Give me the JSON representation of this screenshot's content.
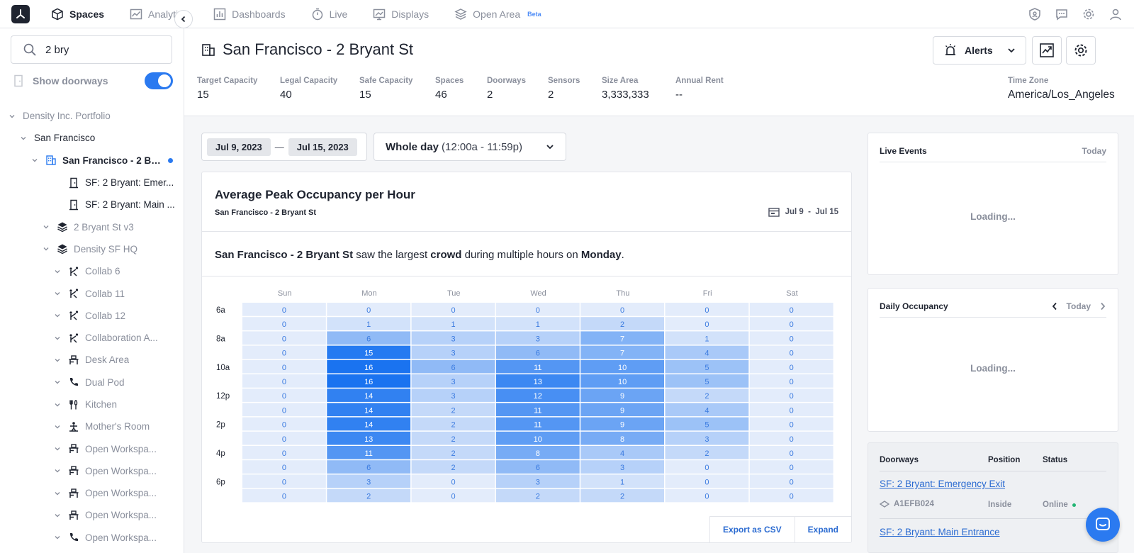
{
  "nav": {
    "items": [
      {
        "label": "Spaces",
        "icon": "cube-icon",
        "active": true
      },
      {
        "label": "Analytics",
        "icon": "chart-image-icon"
      },
      {
        "label": "Dashboards",
        "icon": "bar-chart-icon"
      },
      {
        "label": "Live",
        "icon": "stopwatch-icon"
      },
      {
        "label": "Displays",
        "icon": "display-icon"
      },
      {
        "label": "Open Area",
        "icon": "layers-icon",
        "badge": "Beta"
      }
    ],
    "right_icons": [
      "shield-user-icon",
      "chat-icon",
      "gear-icon",
      "user-icon"
    ]
  },
  "sidebar": {
    "search_value": "2 bry",
    "doorways_label": "Show doorways",
    "doorways_on": true,
    "tree": [
      {
        "label": "Density Inc. Portfolio",
        "indent": 0,
        "icon": ""
      },
      {
        "label": "San Francisco",
        "indent": 1,
        "icon": "",
        "dark": true
      },
      {
        "label": "San Francisco - 2 Br...",
        "indent": 2,
        "icon": "building-icon",
        "selected": true
      },
      {
        "label": "SF: 2 Bryant: Emer...",
        "indent": 3,
        "icon": "doorway-icon",
        "dark": true,
        "nochev": true
      },
      {
        "label": "SF: 2 Bryant: Main ...",
        "indent": 3,
        "icon": "doorway-icon",
        "dark": true,
        "nochev": true
      },
      {
        "label": "2 Bryant St v3",
        "indent": 3,
        "icon": "layers-icon"
      },
      {
        "label": "Density SF HQ",
        "indent": 3,
        "icon": "layers-icon"
      },
      {
        "label": "Collab 6",
        "indent": 4,
        "icon": "collab-icon"
      },
      {
        "label": "Collab 11",
        "indent": 4,
        "icon": "collab-icon"
      },
      {
        "label": "Collab 12",
        "indent": 4,
        "icon": "collab-icon"
      },
      {
        "label": "Collaboration A...",
        "indent": 4,
        "icon": "collab-icon"
      },
      {
        "label": "Desk Area",
        "indent": 4,
        "icon": "desk-icon"
      },
      {
        "label": "Dual Pod",
        "indent": 4,
        "icon": "phone-icon"
      },
      {
        "label": "Kitchen",
        "indent": 4,
        "icon": "utensils-icon"
      },
      {
        "label": "Mother's Room",
        "indent": 4,
        "icon": "person-icon"
      },
      {
        "label": "Open Workspa...",
        "indent": 4,
        "icon": "desk-icon"
      },
      {
        "label": "Open Workspa...",
        "indent": 4,
        "icon": "desk-icon"
      },
      {
        "label": "Open Workspa...",
        "indent": 4,
        "icon": "desk-icon"
      },
      {
        "label": "Open Workspa...",
        "indent": 4,
        "icon": "desk-icon"
      },
      {
        "label": "Open Workspa...",
        "indent": 4,
        "icon": "phone-icon"
      }
    ]
  },
  "header": {
    "title": "San Francisco - 2 Bryant St",
    "alerts_label": "Alerts",
    "stats": [
      {
        "label": "Target Capacity",
        "value": "15"
      },
      {
        "label": "Legal Capacity",
        "value": "40"
      },
      {
        "label": "Safe Capacity",
        "value": "15"
      },
      {
        "label": "Spaces",
        "value": "46"
      },
      {
        "label": "Doorways",
        "value": "2"
      },
      {
        "label": "Sensors",
        "value": "2"
      },
      {
        "label": "Size Area",
        "value": "3,333,333"
      },
      {
        "label": "Annual Rent",
        "value": "--"
      }
    ],
    "timezone_label": "Time Zone",
    "timezone_value": "America/Los_Angeles"
  },
  "controls": {
    "date_start": "Jul 9, 2023",
    "date_sep": "—",
    "date_end": "Jul 15, 2023",
    "time_bold": "Whole day",
    "time_range": "(12:00a - 11:59p)"
  },
  "card": {
    "title": "Average Peak Occupancy per Hour",
    "subtitle": "San Francisco - 2 Bryant St",
    "range_label": "Jul 9  -  Jul 15",
    "insight": {
      "space": "San Francisco - 2 Bryant St",
      "t1": " saw the largest ",
      "word": "crowd",
      "t2": " during multiple hours on ",
      "day": "Monday",
      "t3": "."
    },
    "export_label": "Export as CSV",
    "expand_label": "Expand"
  },
  "chart_data": {
    "type": "heatmap",
    "columns": [
      "Sun",
      "Mon",
      "Tue",
      "Wed",
      "Thu",
      "Fri",
      "Sat"
    ],
    "row_labels": [
      "6a",
      "",
      "8a",
      "",
      "10a",
      "",
      "12p",
      "",
      "2p",
      "",
      "4p",
      "",
      "6p",
      ""
    ],
    "values": [
      [
        0,
        0,
        0,
        0,
        0,
        0,
        0
      ],
      [
        0,
        1,
        1,
        1,
        2,
        0,
        0
      ],
      [
        0,
        6,
        3,
        3,
        7,
        1,
        0
      ],
      [
        0,
        15,
        3,
        6,
        7,
        4,
        0
      ],
      [
        0,
        16,
        6,
        11,
        10,
        5,
        0
      ],
      [
        0,
        16,
        3,
        13,
        10,
        5,
        0
      ],
      [
        0,
        14,
        3,
        12,
        9,
        2,
        0
      ],
      [
        0,
        14,
        2,
        11,
        9,
        4,
        0
      ],
      [
        0,
        14,
        2,
        11,
        9,
        5,
        0
      ],
      [
        0,
        13,
        2,
        10,
        8,
        3,
        0
      ],
      [
        0,
        11,
        2,
        8,
        4,
        2,
        0
      ],
      [
        0,
        6,
        2,
        6,
        3,
        0,
        0
      ],
      [
        0,
        3,
        0,
        3,
        1,
        0,
        0
      ],
      [
        0,
        2,
        0,
        2,
        2,
        0,
        0
      ]
    ],
    "max": 16,
    "colors": {
      "low": "#e3ecfb",
      "high": "#1a73f0",
      "text_light": "#ffffff",
      "text_dark": "#3b7be0"
    }
  },
  "live_events": {
    "title": "Live Events",
    "right": "Today",
    "loading": "Loading..."
  },
  "daily_occupancy": {
    "title": "Daily Occupancy",
    "right": "Today",
    "loading": "Loading..."
  },
  "doorways_table": {
    "headers": [
      "Doorways",
      "Position",
      "Status"
    ],
    "rows": [
      {
        "name": "SF: 2 Bryant: Emergency Exit",
        "sensor": "A1EFB024",
        "position": "Inside",
        "status": "Online"
      },
      {
        "name": "SF: 2 Bryant: Main Entrance",
        "sensor": "",
        "position": "",
        "status": ""
      }
    ]
  }
}
